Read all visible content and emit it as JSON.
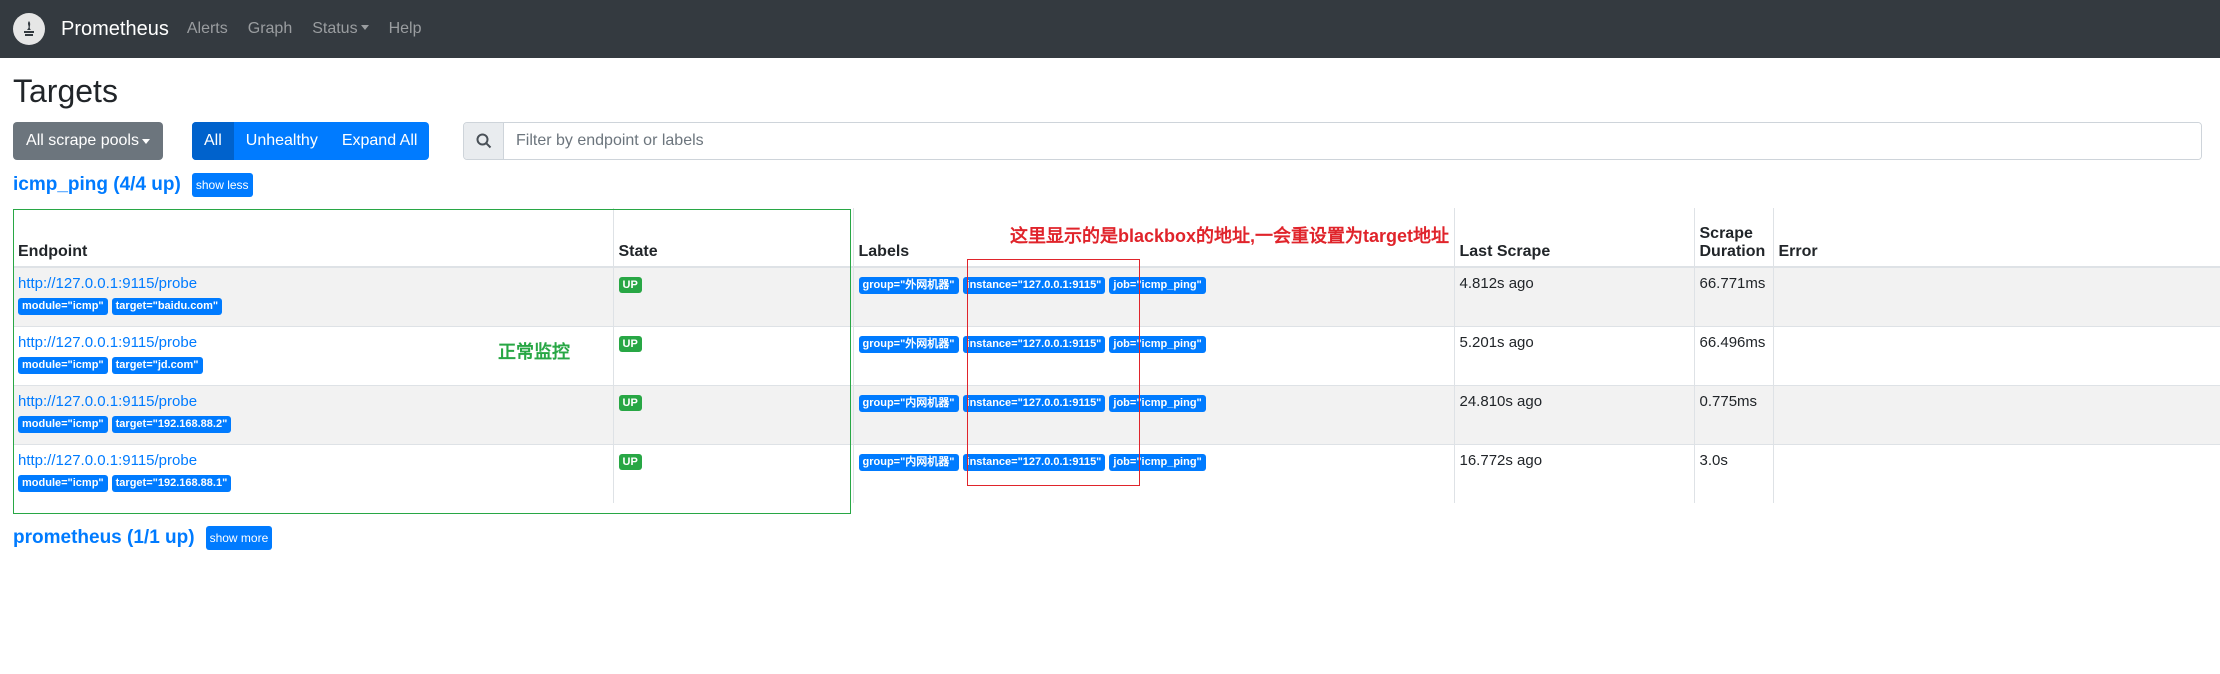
{
  "navbar": {
    "brand": "Prometheus",
    "links": [
      "Alerts",
      "Graph",
      "Status",
      "Help"
    ]
  },
  "page": {
    "title": "Targets",
    "pools_button": "All scrape pools",
    "filters": [
      "All",
      "Unhealthy",
      "Expand All"
    ],
    "search_placeholder": "Filter by endpoint or labels"
  },
  "pools": [
    {
      "title": "icmp_ping (4/4 up)",
      "toggle": "show less",
      "columns": [
        "Endpoint",
        "State",
        "Labels",
        "Last Scrape",
        "Scrape Duration",
        "Error"
      ],
      "rows": [
        {
          "endpoint": "http://127.0.0.1:9115/probe",
          "params": [
            "module=\"icmp\"",
            "target=\"baidu.com\""
          ],
          "state": "UP",
          "labels": [
            "group=\"外网机器\"",
            "instance=\"127.0.0.1:9115\"",
            "job=\"icmp_ping\""
          ],
          "last_scrape": "4.812s ago",
          "duration": "66.771ms",
          "error": ""
        },
        {
          "endpoint": "http://127.0.0.1:9115/probe",
          "params": [
            "module=\"icmp\"",
            "target=\"jd.com\""
          ],
          "state": "UP",
          "labels": [
            "group=\"外网机器\"",
            "instance=\"127.0.0.1:9115\"",
            "job=\"icmp_ping\""
          ],
          "last_scrape": "5.201s ago",
          "duration": "66.496ms",
          "error": ""
        },
        {
          "endpoint": "http://127.0.0.1:9115/probe",
          "params": [
            "module=\"icmp\"",
            "target=\"192.168.88.2\""
          ],
          "state": "UP",
          "labels": [
            "group=\"内网机器\"",
            "instance=\"127.0.0.1:9115\"",
            "job=\"icmp_ping\""
          ],
          "last_scrape": "24.810s ago",
          "duration": "0.775ms",
          "error": ""
        },
        {
          "endpoint": "http://127.0.0.1:9115/probe",
          "params": [
            "module=\"icmp\"",
            "target=\"192.168.88.1\""
          ],
          "state": "UP",
          "labels": [
            "group=\"内网机器\"",
            "instance=\"127.0.0.1:9115\"",
            "job=\"icmp_ping\""
          ],
          "last_scrape": "16.772s ago",
          "duration": "3.0s",
          "error": ""
        }
      ]
    },
    {
      "title": "prometheus (1/1 up)",
      "toggle": "show more"
    }
  ],
  "annotations": {
    "green_note": "正常监控",
    "red_note": "这里显示的是blackbox的地址,一会重设置为target地址"
  },
  "colors": {
    "navbar": "#343a40",
    "primary": "#007bff",
    "success": "#28a745",
    "annotation_red": "#e0242b"
  }
}
